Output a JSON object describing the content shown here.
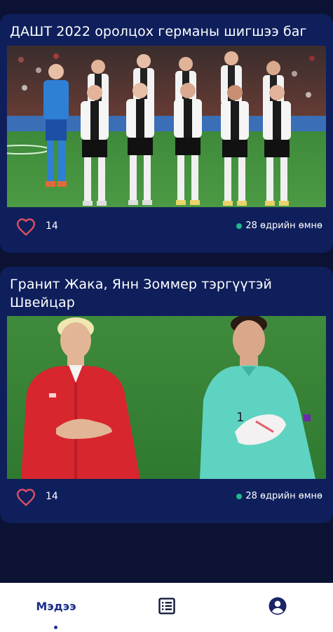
{
  "feed": {
    "cards": [
      {
        "title": "ДАШТ 2022 оролцох германы шигшээ баг",
        "likes": "14",
        "time": "28 өдрийн өмнө",
        "image": "germany-team-photo"
      },
      {
        "title": "Гранит Жака, Янн Зоммер тэргүүтэй Швейцар",
        "likes": "14",
        "time": "28 өдрийн өмнө",
        "image": "switzerland-players-photo"
      }
    ]
  },
  "bottom_nav": {
    "items": [
      {
        "label": "Мэдээ",
        "icon": "news",
        "active": true
      },
      {
        "label": "",
        "icon": "list-icon",
        "active": false
      },
      {
        "label": "",
        "icon": "profile-icon",
        "active": false
      }
    ]
  },
  "colors": {
    "background": "#0b1233",
    "card": "#0f1f5c",
    "accent": "#1d2f8a",
    "like": "#e05064",
    "status": "#1db98a"
  }
}
